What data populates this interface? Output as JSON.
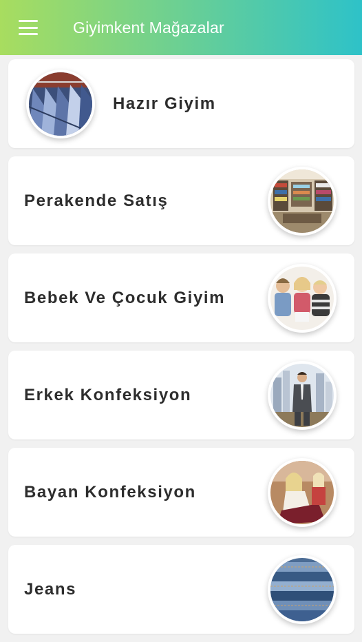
{
  "appbar": {
    "title": "Giyimkent Mağazalar",
    "menu_icon": "hamburger-menu-icon",
    "gradient_start": "#a8dd5f",
    "gradient_end": "#2ec2c8"
  },
  "categories": [
    {
      "label": "Hazır Giyim",
      "image": "clothing-rack-image",
      "image_side": "left"
    },
    {
      "label": "Perakende Satış",
      "image": "retail-store-image",
      "image_side": "right"
    },
    {
      "label": "Bebek Ve Çocuk Giyim",
      "image": "children-image",
      "image_side": "right"
    },
    {
      "label": "Erkek Konfeksiyon",
      "image": "man-in-suit-image",
      "image_side": "right"
    },
    {
      "label": "Bayan Konfeksiyon",
      "image": "woman-fashion-image",
      "image_side": "right"
    },
    {
      "label": "Jeans",
      "image": "stacked-jeans-image",
      "image_side": "right"
    }
  ]
}
